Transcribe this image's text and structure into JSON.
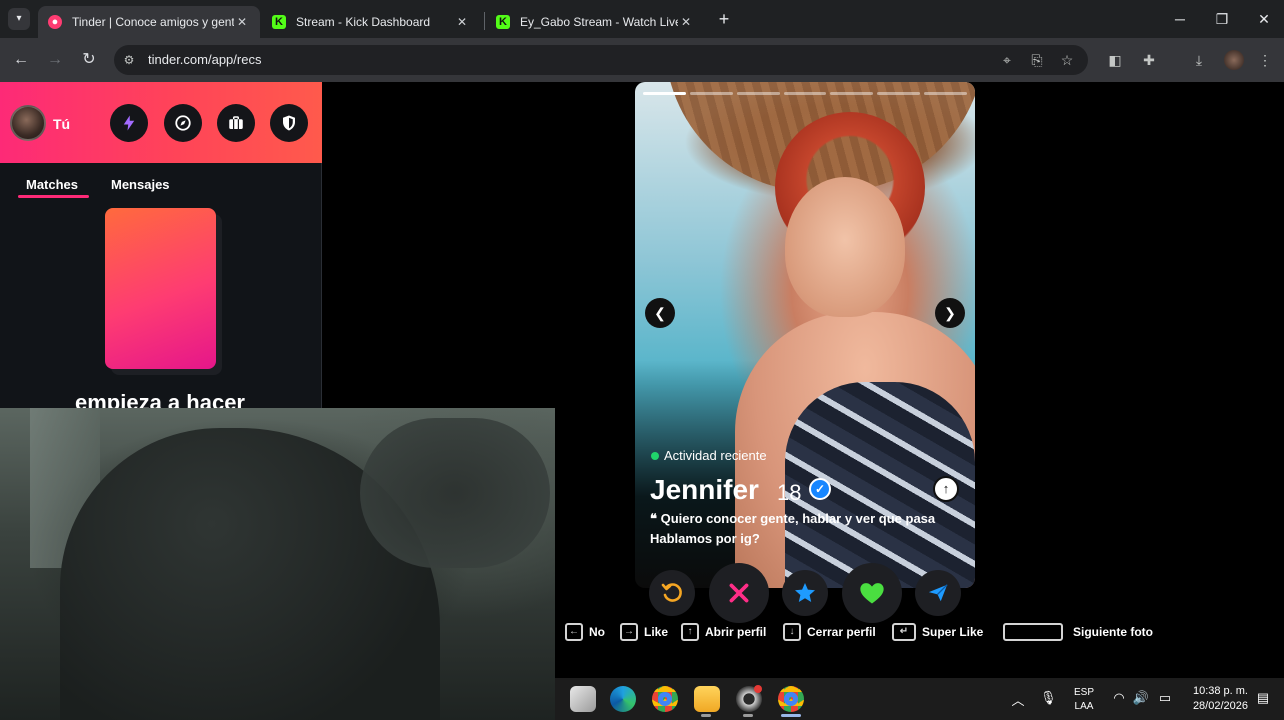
{
  "browser": {
    "tabs": [
      {
        "label": "Tinder | Conoce amigos y gente",
        "active": true,
        "favicon": "tinder-icon",
        "color": "#fe3c72"
      },
      {
        "label": "Stream - Kick Dashboard",
        "active": false,
        "favicon": "kick-icon",
        "color": "#53fc18"
      },
      {
        "label": "Ey_Gabo Stream - Watch Live on",
        "active": false,
        "favicon": "kick-icon",
        "color": "#53fc18"
      }
    ],
    "new_tab_label": "+",
    "url": "tinder.com/app/recs"
  },
  "sidebar": {
    "user_label": "Tú",
    "subtabs": {
      "matches": "Matches",
      "messages": "Mensajes"
    },
    "promo_text": "empieza a hacer",
    "header_buttons": [
      "boost-icon",
      "explore-icon",
      "briefcase-icon",
      "shield-icon"
    ],
    "accent_color": "#fd2a77"
  },
  "profile": {
    "activity": "Actividad reciente",
    "name": "Jennifer",
    "age": "18",
    "bio_line1": "Quiero conocer gente, hablar y ver que pasa",
    "bio_line2": "Hablamos por ig?",
    "photo_count": 7,
    "current_photo": 1
  },
  "actions": [
    {
      "name": "rewind-button",
      "icon": "rewind-icon",
      "color": "#f5a623"
    },
    {
      "name": "nope-button",
      "icon": "close-icon",
      "color": "#ff2d87"
    },
    {
      "name": "super-like-button",
      "icon": "star-icon",
      "color": "#1e9bff"
    },
    {
      "name": "like-button",
      "icon": "heart-icon",
      "color": "#4ade40"
    },
    {
      "name": "boost-button",
      "icon": "send-icon",
      "color": "#1e9bff"
    }
  ],
  "hints": {
    "no": "No",
    "like": "Like",
    "open_profile": "Abrir perfil",
    "close_profile": "Cerrar perfil",
    "super_like": "Super Like",
    "next_photo": "Siguiente foto"
  },
  "taskbar": {
    "lang_top": "ESP",
    "lang_bottom": "LAA",
    "time": "10:38 p. m.",
    "date": "28/02/2026"
  }
}
